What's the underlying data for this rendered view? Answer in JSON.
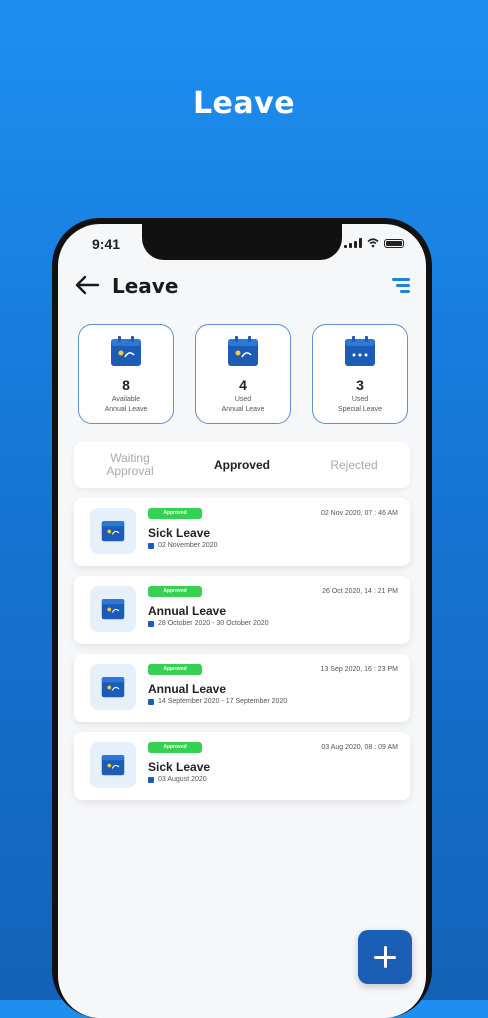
{
  "hero": {
    "title": "Leave"
  },
  "status_bar": {
    "time": "9:41"
  },
  "header": {
    "title": "Leave"
  },
  "stats": [
    {
      "value": "8",
      "label_line1": "Available",
      "label_line2": "Annual Leave"
    },
    {
      "value": "4",
      "label_line1": "Used",
      "label_line2": "Annual Leave"
    },
    {
      "value": "3",
      "label_line1": "Used",
      "label_line2": "Special Leave"
    }
  ],
  "tabs": [
    {
      "label_line1": "Waiting",
      "label_line2": "Approval",
      "active": false
    },
    {
      "label_line1": "Approved",
      "label_line2": "",
      "active": true
    },
    {
      "label_line1": "Rejected",
      "label_line2": "",
      "active": false
    }
  ],
  "leaves": [
    {
      "status": "Approved",
      "submitted": "02 Nov 2020, 07 : 46 AM",
      "type": "Sick Leave",
      "range": "02 November 2020"
    },
    {
      "status": "Approved",
      "submitted": "26 Oct 2020, 14 : 21 PM",
      "type": "Annual Leave",
      "range": "28 October 2020 - 30 October 2020"
    },
    {
      "status": "Approved",
      "submitted": "13 Sep 2020, 16 : 23 PM",
      "type": "Annual Leave",
      "range": "14 September 2020 - 17 September 2020"
    },
    {
      "status": "Approved",
      "submitted": "03 Aug 2020, 08 : 09 AM",
      "type": "Sick Leave",
      "range": "03 August 2020"
    }
  ],
  "icons": {
    "back": "arrow-left-icon",
    "filter": "filter-icon",
    "calendar": "calendar-icon",
    "add": "plus-icon"
  },
  "colors": {
    "primary": "#1b5eb6",
    "accent": "#1c82e0",
    "approved_badge": "#36d152"
  }
}
